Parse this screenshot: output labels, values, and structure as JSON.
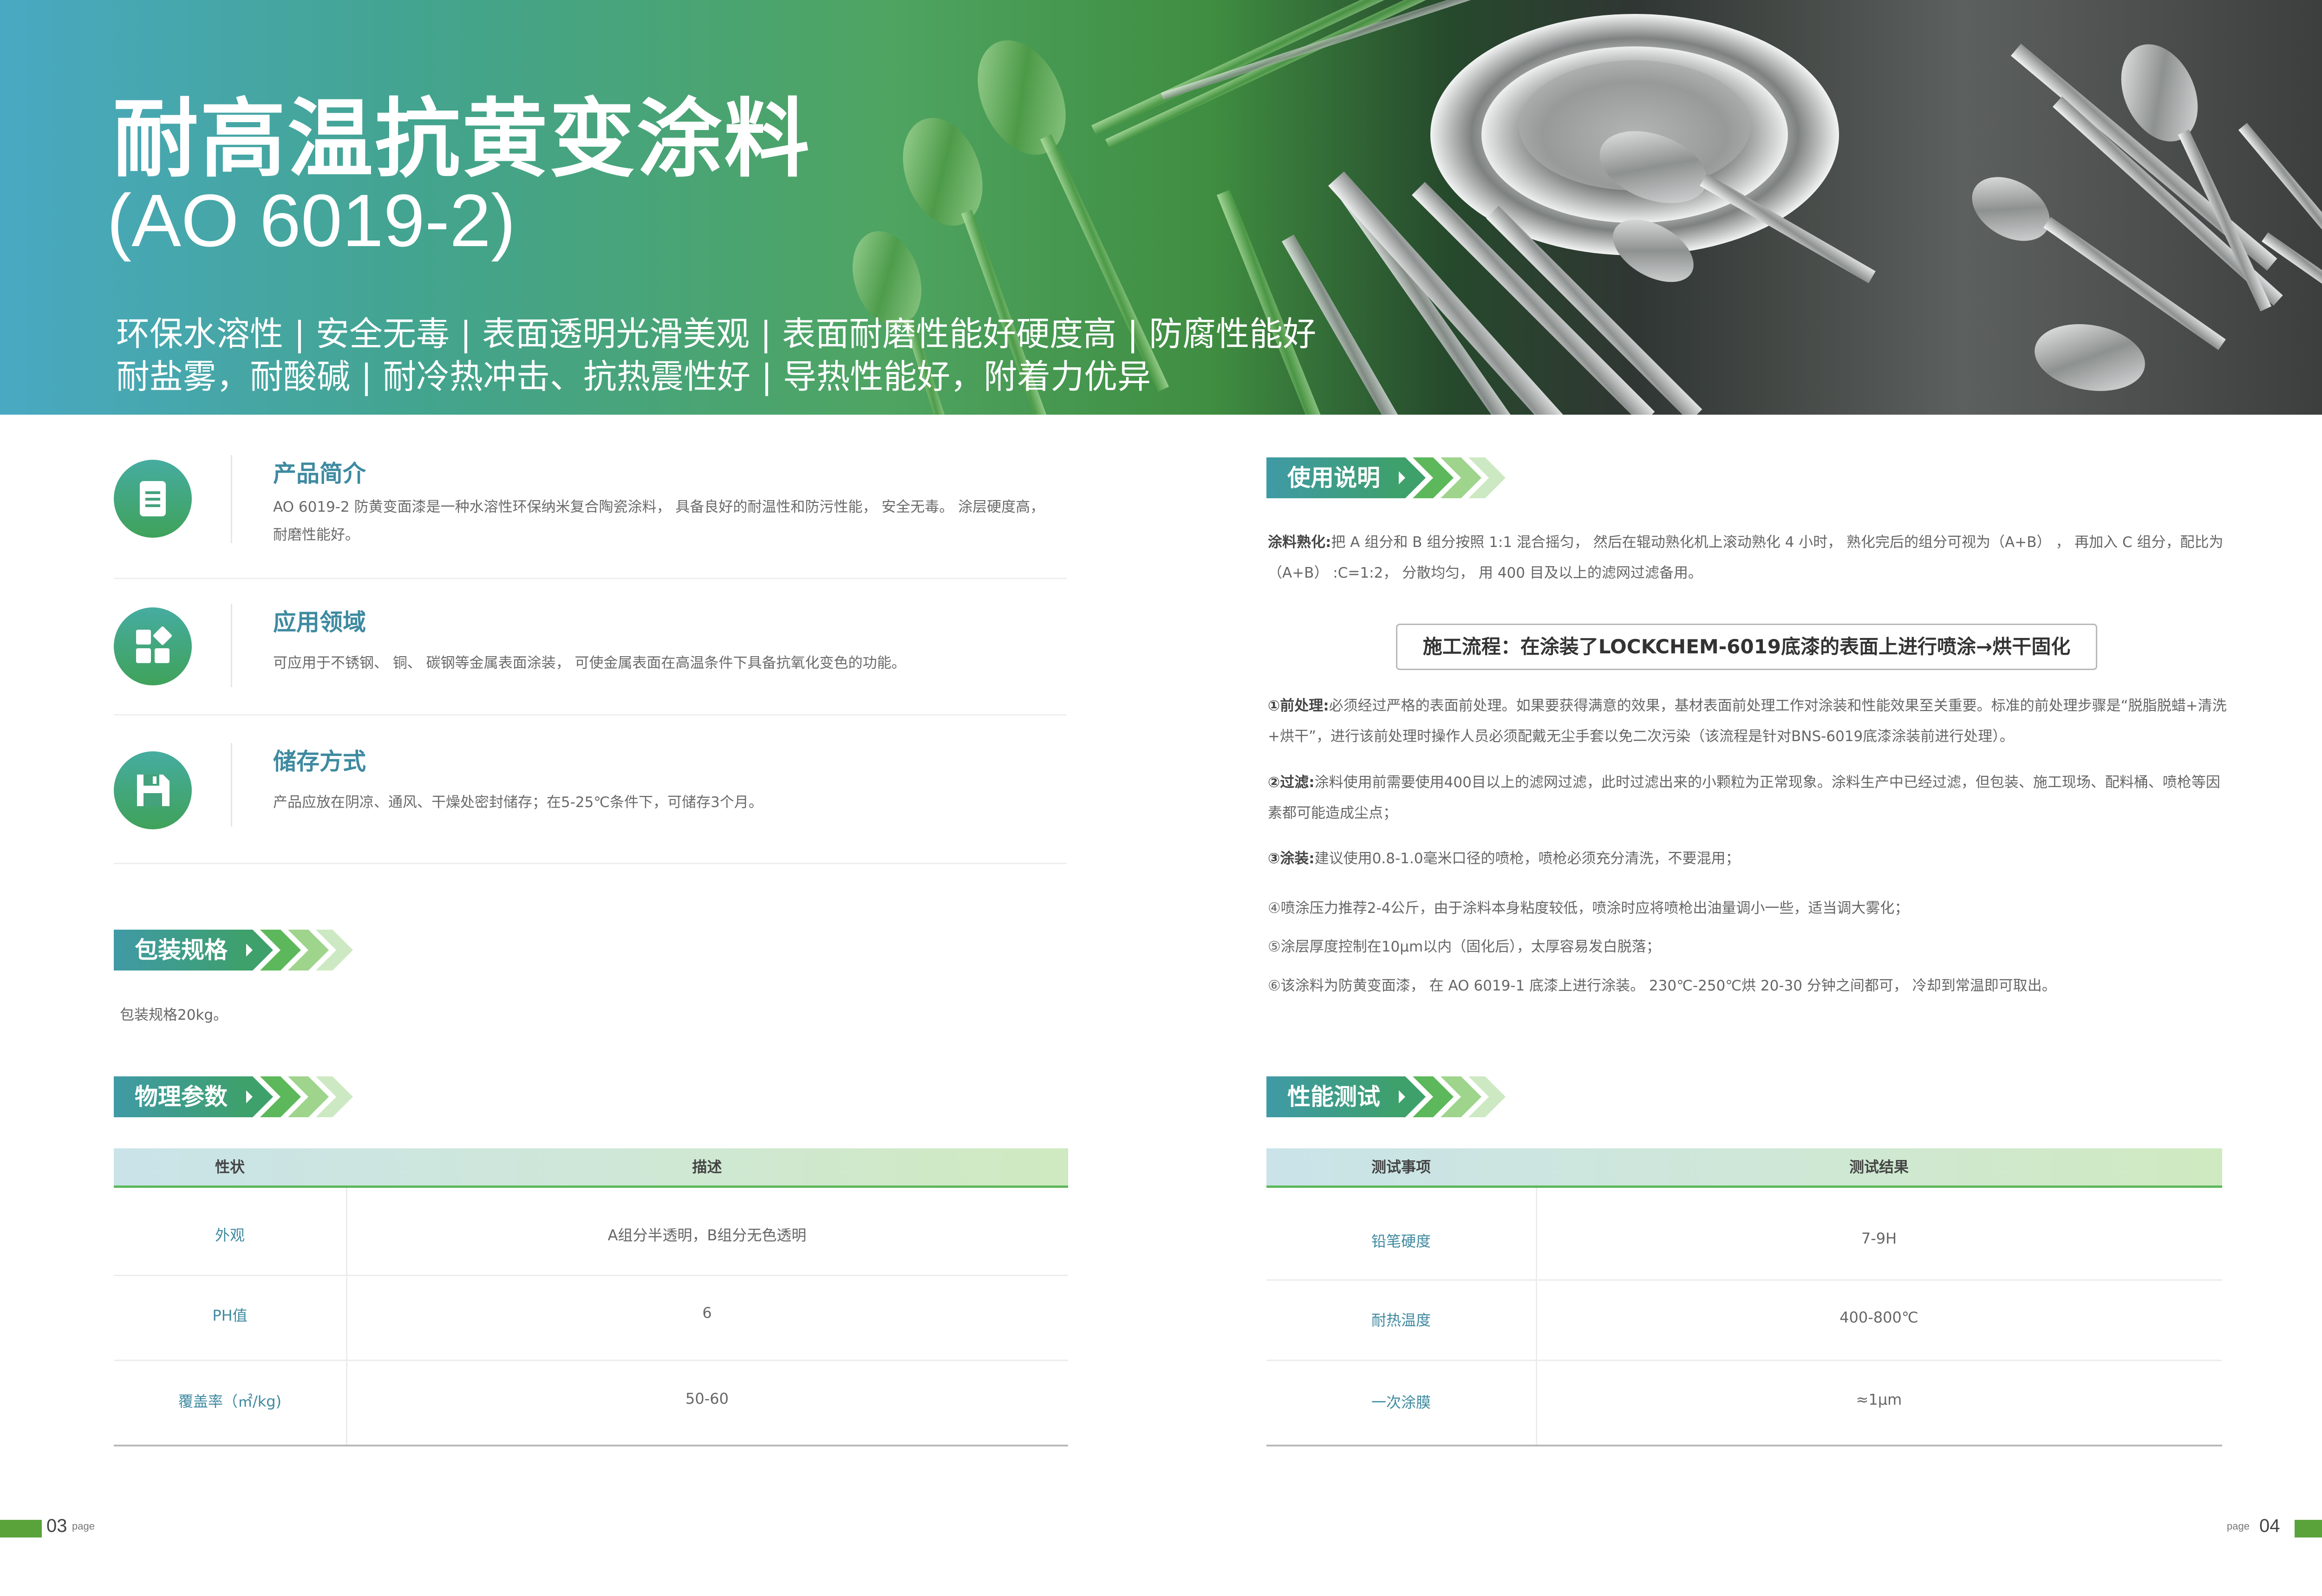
{
  "header": {
    "title": "耐高温抗黄变涂料",
    "model": "(AO 6019-2)",
    "features_line1": "环保水溶性 | 安全无毒 | 表面透明光滑美观 | 表面耐磨性能好硬度高 | 防腐性能好",
    "features_line2": "耐盐雾，耐酸碱 | 耐冷热冲击、抗热震性好 | 导热性能好，附着力优异"
  },
  "intro": {
    "title": "产品简介",
    "text": "AO 6019-2 防黄变面漆是一种水溶性环保纳米复合陶瓷涂料， 具备良好的耐温性和防污性能， 安全无毒。 涂层硬度高， 耐磨性能好。",
    "icon": "document-icon"
  },
  "application": {
    "title": "应用领域",
    "text": "可应用于不锈钢、 铜、 碳钢等金属表面涂装， 可使金属表面在高温条件下具备抗氧化变色的功能。",
    "icon": "grid-icon"
  },
  "storage": {
    "title": "储存方式",
    "text": "产品应放在阴凉、通风、干燥处密封储存；在5-25℃条件下，可储存3个月。",
    "icon": "save-icon"
  },
  "packaging": {
    "tag": "包装规格",
    "text": "包装规格20kg。"
  },
  "physical": {
    "tag": "物理参数",
    "headers": [
      "性状",
      "描述"
    ],
    "rows": [
      {
        "key": "外观",
        "value": "A组分半透明，B组分无色透明"
      },
      {
        "key": "PH值",
        "value": "6"
      },
      {
        "key": "覆盖率（㎡/kg)",
        "value": "50-60"
      }
    ]
  },
  "usage": {
    "tag": "使用说明",
    "curing_label": "涂料熟化:",
    "curing_text": "把 A 组分和 B 组分按照 1:1 混合摇匀， 然后在辊动熟化机上滚动熟化 4 小时， 熟化完后的组分可视为（A+B） ， 再加入 C 组分，配比为（A+B） :C=1:2， 分散均匀， 用 400 目及以上的滤网过滤备用。",
    "flow": "施工流程：在涂装了LOCKCHEM-6019底漆的表面上进行喷涂→烘干固化",
    "steps": [
      {
        "label": "①前处理:",
        "text": "必须经过严格的表面前处理。如果要获得满意的效果，基材表面前处理工作对涂装和性能效果至关重要。标准的前处理步骤是“脱脂脱蜡+清洗+烘干”，进行该前处理时操作人员必须配戴无尘手套以免二次污染（该流程是针对BNS-6019底漆涂装前进行处理）。"
      },
      {
        "label": "②过滤:",
        "text": "涂料使用前需要使用400目以上的滤网过滤，此时过滤出来的小颗粒为正常现象。涂料生产中已经过滤，但包装、施工现场、配料桶、喷枪等因素都可能造成尘点；"
      },
      {
        "label": "③涂装:",
        "text": "建议使用0.8-1.0毫米口径的喷枪，喷枪必须充分清洗，不要混用；"
      },
      {
        "label": "",
        "text": "④喷涂压力推荐2-4公斤，由于涂料本身粘度较低，喷涂时应将喷枪出油量调小一些，适当调大雾化；"
      },
      {
        "label": "",
        "text": "⑤涂层厚度控制在10μm以内（固化后），太厚容易发白脱落；"
      },
      {
        "label": "",
        "text": "⑥该涂料为防黄变面漆， 在 AO 6019-1 底漆上进行涂装。 230℃-250℃烘 20-30 分钟之间都可， 冷却到常温即可取出。"
      }
    ]
  },
  "performance": {
    "tag": "性能测试",
    "headers": [
      "测试事项",
      "测试结果"
    ],
    "rows": [
      {
        "key": "铅笔硬度",
        "value": "7-9H"
      },
      {
        "key": "耐热温度",
        "value": "400-800℃"
      },
      {
        "key": "一次涂膜",
        "value": "≈1μm"
      }
    ]
  },
  "footer": {
    "left_num": "03",
    "left_word": "page",
    "right_word": "page",
    "right_num": "04"
  },
  "colors": {
    "accent_teal": "#3e8aa0",
    "accent_green": "#5aa33b"
  }
}
